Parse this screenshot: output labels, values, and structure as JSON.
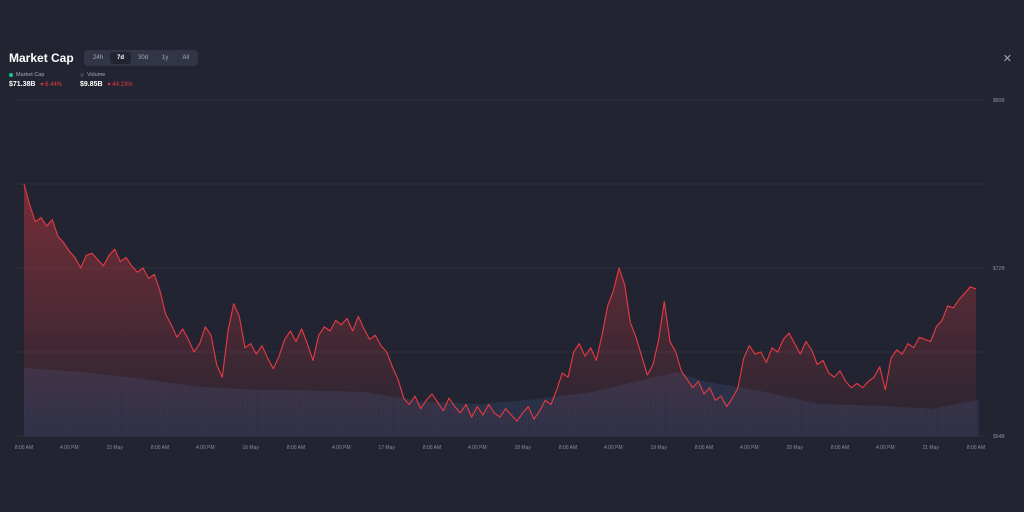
{
  "header": {
    "title": "Market Cap",
    "tabs": [
      {
        "label": "24h",
        "active": false
      },
      {
        "label": "7d",
        "active": true
      },
      {
        "label": "30d",
        "active": false
      },
      {
        "label": "1y",
        "active": false
      },
      {
        "label": "All",
        "active": false
      }
    ],
    "close_icon": "close-icon"
  },
  "legend": {
    "market_cap": {
      "label": "Market Cap",
      "value": "$71.38B",
      "change": "6.44%",
      "dot_color": "#16c784"
    },
    "volume": {
      "label": "Volume",
      "value": "$9.85B",
      "change": "44.23%",
      "dot_color": "#3a3f55"
    }
  },
  "colors": {
    "line": "#ea3943",
    "area_top": "#ea3943",
    "volume": "#33405e",
    "grid": "#3a3d4c",
    "background": "#222531"
  },
  "chart_data": {
    "type": "line",
    "title": "Market Cap",
    "subtitle": "",
    "xlabel": "",
    "ylabel": "",
    "y_ticks": [
      "$80B",
      "$72B",
      "$64B"
    ],
    "ylim": [
      64,
      80
    ],
    "x_ticks": [
      "8:00 AM",
      "4:00 PM",
      "15 May",
      "8:00 AM",
      "4:00 PM",
      "16 May",
      "8:00 AM",
      "4:00 PM",
      "17 May",
      "8:00 AM",
      "4:00 PM",
      "18 May",
      "8:00 AM",
      "4:00 PM",
      "19 May",
      "8:00 AM",
      "4:00 PM",
      "20 May",
      "8:00 AM",
      "4:00 PM",
      "21 May",
      "8:00 AM"
    ],
    "x_range_hours": [
      0,
      168
    ],
    "grid": true,
    "legend": "top-left",
    "series": [
      {
        "name": "Market Cap",
        "unit": "$B",
        "points": [
          [
            0,
            76.0
          ],
          [
            1,
            75.0
          ],
          [
            2,
            74.2
          ],
          [
            3,
            74.4
          ],
          [
            4,
            74.0
          ],
          [
            5,
            74.3
          ],
          [
            6,
            73.5
          ],
          [
            7,
            73.2
          ],
          [
            8,
            72.8
          ],
          [
            9,
            72.5
          ],
          [
            10,
            72.0
          ],
          [
            11,
            72.6
          ],
          [
            12,
            72.7
          ],
          [
            13,
            72.4
          ],
          [
            14,
            72.1
          ],
          [
            15,
            72.6
          ],
          [
            16,
            72.9
          ],
          [
            17,
            72.3
          ],
          [
            18,
            72.5
          ],
          [
            19,
            72.1
          ],
          [
            20,
            71.8
          ],
          [
            21,
            72.0
          ],
          [
            22,
            71.5
          ],
          [
            23,
            71.7
          ],
          [
            24,
            70.9
          ],
          [
            25,
            69.8
          ],
          [
            26,
            69.3
          ],
          [
            27,
            68.7
          ],
          [
            28,
            69.1
          ],
          [
            29,
            68.6
          ],
          [
            30,
            68.0
          ],
          [
            31,
            68.4
          ],
          [
            32,
            69.2
          ],
          [
            33,
            68.8
          ],
          [
            34,
            67.4
          ],
          [
            35,
            66.8
          ],
          [
            36,
            69.0
          ],
          [
            37,
            70.3
          ],
          [
            38,
            69.7
          ],
          [
            39,
            68.2
          ],
          [
            40,
            68.4
          ],
          [
            41,
            67.9
          ],
          [
            42,
            68.3
          ],
          [
            43,
            67.7
          ],
          [
            44,
            67.2
          ],
          [
            45,
            67.8
          ],
          [
            46,
            68.6
          ],
          [
            47,
            69.0
          ],
          [
            48,
            68.5
          ],
          [
            49,
            69.1
          ],
          [
            50,
            68.4
          ],
          [
            51,
            67.6
          ],
          [
            52,
            68.8
          ],
          [
            53,
            69.2
          ],
          [
            54,
            69.0
          ],
          [
            55,
            69.5
          ],
          [
            56,
            69.3
          ],
          [
            57,
            69.6
          ],
          [
            58,
            69.0
          ],
          [
            59,
            69.7
          ],
          [
            60,
            69.1
          ],
          [
            61,
            68.6
          ],
          [
            62,
            68.8
          ],
          [
            63,
            68.3
          ],
          [
            64,
            68.0
          ],
          [
            65,
            67.3
          ],
          [
            66,
            66.7
          ],
          [
            67,
            65.8
          ],
          [
            68,
            65.5
          ],
          [
            69,
            65.9
          ],
          [
            70,
            65.3
          ],
          [
            71,
            65.7
          ],
          [
            72,
            66.0
          ],
          [
            73,
            65.6
          ],
          [
            74,
            65.2
          ],
          [
            75,
            65.8
          ],
          [
            76,
            65.4
          ],
          [
            77,
            65.1
          ],
          [
            78,
            65.5
          ],
          [
            79,
            64.9
          ],
          [
            80,
            65.4
          ],
          [
            81,
            65.0
          ],
          [
            82,
            65.5
          ],
          [
            83,
            65.1
          ],
          [
            84,
            64.9
          ],
          [
            85,
            65.3
          ],
          [
            86,
            65.0
          ],
          [
            87,
            64.7
          ],
          [
            88,
            65.1
          ],
          [
            89,
            65.4
          ],
          [
            90,
            64.8
          ],
          [
            91,
            65.2
          ],
          [
            92,
            65.7
          ],
          [
            93,
            65.5
          ],
          [
            94,
            66.2
          ],
          [
            95,
            67.0
          ],
          [
            96,
            66.8
          ],
          [
            97,
            68.0
          ],
          [
            98,
            68.4
          ],
          [
            99,
            67.8
          ],
          [
            100,
            68.2
          ],
          [
            101,
            67.6
          ],
          [
            102,
            68.8
          ],
          [
            103,
            70.2
          ],
          [
            104,
            70.9
          ],
          [
            105,
            72.0
          ],
          [
            106,
            71.2
          ],
          [
            107,
            69.4
          ],
          [
            108,
            68.7
          ],
          [
            109,
            67.8
          ],
          [
            110,
            66.9
          ],
          [
            111,
            67.4
          ],
          [
            112,
            68.6
          ],
          [
            113,
            70.4
          ],
          [
            114,
            68.5
          ],
          [
            115,
            68.0
          ],
          [
            116,
            67.1
          ],
          [
            117,
            66.7
          ],
          [
            118,
            66.3
          ],
          [
            119,
            66.6
          ],
          [
            120,
            66.0
          ],
          [
            121,
            66.3
          ],
          [
            122,
            65.7
          ],
          [
            123,
            65.9
          ],
          [
            124,
            65.4
          ],
          [
            125,
            65.8
          ],
          [
            126,
            66.3
          ],
          [
            127,
            67.7
          ],
          [
            128,
            68.3
          ],
          [
            129,
            67.9
          ],
          [
            130,
            68.0
          ],
          [
            131,
            67.5
          ],
          [
            132,
            68.2
          ],
          [
            133,
            68.0
          ],
          [
            134,
            68.6
          ],
          [
            135,
            68.9
          ],
          [
            136,
            68.4
          ],
          [
            137,
            67.9
          ],
          [
            138,
            68.5
          ],
          [
            139,
            68.1
          ],
          [
            140,
            67.4
          ],
          [
            141,
            67.6
          ],
          [
            142,
            67.0
          ],
          [
            143,
            66.8
          ],
          [
            144,
            67.1
          ],
          [
            145,
            66.6
          ],
          [
            146,
            66.3
          ],
          [
            147,
            66.5
          ],
          [
            148,
            66.3
          ],
          [
            149,
            66.6
          ],
          [
            150,
            66.8
          ],
          [
            151,
            67.3
          ],
          [
            152,
            66.2
          ],
          [
            153,
            67.7
          ],
          [
            154,
            68.1
          ],
          [
            155,
            67.9
          ],
          [
            156,
            68.4
          ],
          [
            157,
            68.2
          ],
          [
            158,
            68.7
          ],
          [
            159,
            68.6
          ],
          [
            160,
            68.5
          ],
          [
            161,
            69.2
          ],
          [
            162,
            69.5
          ],
          [
            163,
            70.2
          ],
          [
            164,
            70.1
          ],
          [
            165,
            70.5
          ],
          [
            166,
            70.8
          ],
          [
            167,
            71.1
          ],
          [
            168,
            71.0
          ]
        ]
      },
      {
        "name": "Volume",
        "unit": "relative",
        "points": [
          [
            0,
            0.85
          ],
          [
            10,
            0.8
          ],
          [
            20,
            0.72
          ],
          [
            30,
            0.62
          ],
          [
            40,
            0.58
          ],
          [
            50,
            0.57
          ],
          [
            60,
            0.55
          ],
          [
            70,
            0.43
          ],
          [
            80,
            0.4
          ],
          [
            90,
            0.46
          ],
          [
            100,
            0.55
          ],
          [
            110,
            0.72
          ],
          [
            115,
            0.8
          ],
          [
            120,
            0.68
          ],
          [
            130,
            0.56
          ],
          [
            140,
            0.4
          ],
          [
            150,
            0.38
          ],
          [
            160,
            0.34
          ],
          [
            168,
            0.45
          ]
        ]
      }
    ]
  }
}
